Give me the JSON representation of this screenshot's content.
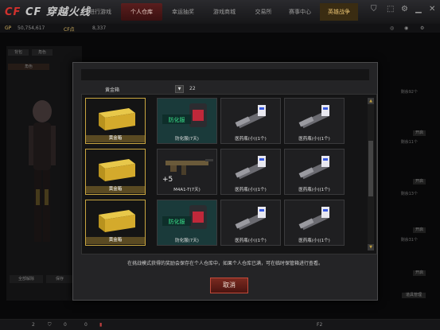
{
  "topbar": {
    "logo": "CF 穿越火线",
    "tabs": [
      "进行游戏",
      "个人仓库",
      "幸运抽奖",
      "游戏商城",
      "交易所",
      "赛事中心"
    ],
    "active_tab": 1,
    "promo": "英雄战争"
  },
  "statbar": {
    "gp_label": "GP",
    "gp": "50,754,617",
    "cf_label": "CF点",
    "cf": "8,337"
  },
  "left": {
    "tabs": [
      "背包",
      "角色"
    ],
    "sub": "角色",
    "buttons": [
      "全部解除",
      "保存"
    ]
  },
  "right": {
    "items": [
      "剩余92个",
      "剩余11个",
      "剩余13个",
      "剩余31个"
    ],
    "open_label": "开启",
    "manage_label": "道具管理"
  },
  "bottombar": {
    "a": "2",
    "b": "0",
    "c": "0",
    "msg": "F2"
  },
  "dialog": {
    "filter_name": "黄金箱",
    "filter_count": "22",
    "rows": [
      {
        "cells": [
          "黄金箱",
          "防化服(7天)",
          "医药瓶(小)(1个)",
          "医药瓶(小)(1个)"
        ]
      },
      {
        "cells": [
          "黄金箱",
          "M4A1-T(7天)",
          "医药瓶(小)(1个)",
          "医药瓶(小)(1个)"
        ]
      },
      {
        "cells": [
          "黄金箱",
          "防化服(7天)",
          "医药瓶(小)(1个)",
          "医药瓶(小)(1个)"
        ]
      }
    ],
    "armor_badge": "防化服",
    "weapon_plus": "+5",
    "note": "在挑战模式获得的奖励会保存在个人仓库中，如果个人仓库已满，可在临时保管箱进行查看。",
    "cancel_label": "取消"
  },
  "colors": {
    "accent": "#c9a640",
    "danger": "#c24a3a"
  }
}
